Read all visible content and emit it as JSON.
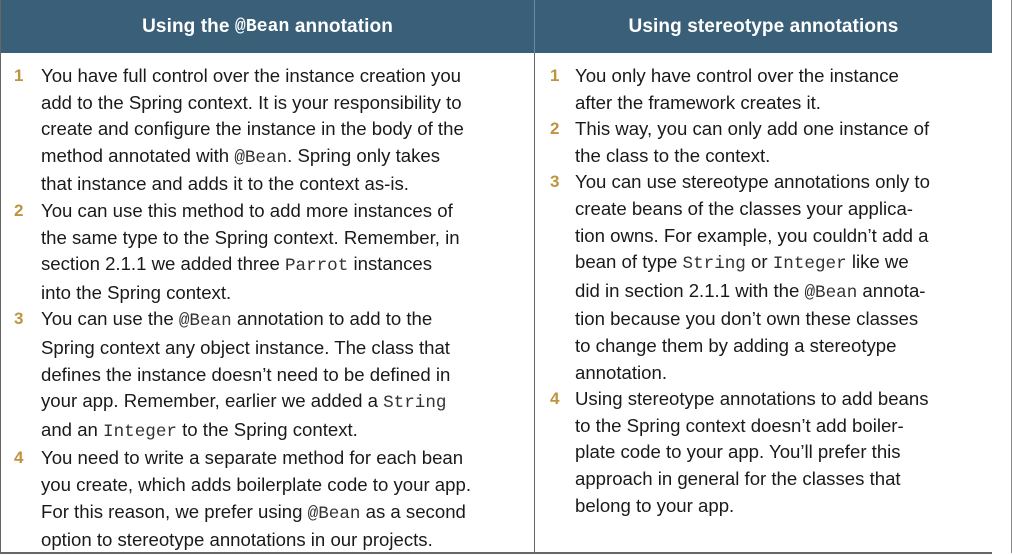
{
  "table": {
    "left_header": {
      "before": "Using the ",
      "code": "@Bean",
      "after": " annotation"
    },
    "right_header": "Using stereotype annotations",
    "left_items": [
      {
        "number": "1",
        "lines": [
          [
            {
              "t": "You have full control over the instance creation you"
            }
          ],
          [
            {
              "t": "add to the Spring context. It is your responsibility to"
            }
          ],
          [
            {
              "t": "create and configure the instance in the body of the"
            }
          ],
          [
            {
              "t": "method annotated with "
            },
            {
              "c": "@Bean"
            },
            {
              "t": ". Spring only takes"
            }
          ],
          [
            {
              "t": "that instance and adds it to the context as-is."
            }
          ]
        ]
      },
      {
        "number": "2",
        "lines": [
          [
            {
              "t": "You can use this method to add more instances of"
            }
          ],
          [
            {
              "t": "the same type to the Spring context. Remember, in"
            }
          ],
          [
            {
              "t": "section 2.1.1 we added three "
            },
            {
              "c": "Parrot"
            },
            {
              "t": " instances"
            }
          ],
          [
            {
              "t": "into the Spring context."
            }
          ]
        ]
      },
      {
        "number": "3",
        "lines": [
          [
            {
              "t": "You can use the "
            },
            {
              "c": "@Bean"
            },
            {
              "t": " annotation to add to the"
            }
          ],
          [
            {
              "t": "Spring context any object instance. The class that"
            }
          ],
          [
            {
              "t": "defines the instance doesn’t need to be defined in"
            }
          ],
          [
            {
              "t": "your app. Remember, earlier we added a "
            },
            {
              "c": "String"
            }
          ],
          [
            {
              "t": "and an "
            },
            {
              "c": "Integer"
            },
            {
              "t": " to the Spring context."
            }
          ]
        ]
      },
      {
        "number": "4",
        "lines": [
          [
            {
              "t": "You need to write a separate method for each bean"
            }
          ],
          [
            {
              "t": "you create, which adds boilerplate code to your app."
            }
          ],
          [
            {
              "t": "For this reason, we prefer using "
            },
            {
              "c": "@Bean"
            },
            {
              "t": " as a second"
            }
          ],
          [
            {
              "t": "option to stereotype annotations in our projects."
            }
          ]
        ]
      }
    ],
    "right_items": [
      {
        "number": "1",
        "lines": [
          [
            {
              "t": "You only have control over the instance"
            }
          ],
          [
            {
              "t": "after the framework creates it."
            }
          ]
        ]
      },
      {
        "number": "2",
        "lines": [
          [
            {
              "t": "This way, you can only add one instance of"
            }
          ],
          [
            {
              "t": "the class to the context."
            }
          ]
        ]
      },
      {
        "number": "3",
        "lines": [
          [
            {
              "t": "You can use stereotype annotations only to"
            }
          ],
          [
            {
              "t": "create beans of the classes your applica-"
            }
          ],
          [
            {
              "t": "tion owns. For example, you couldn’t add a"
            }
          ],
          [
            {
              "t": "bean of type "
            },
            {
              "c": "String"
            },
            {
              "t": " or "
            },
            {
              "c": "Integer"
            },
            {
              "t": " like we"
            }
          ],
          [
            {
              "t": "did in section 2.1.1 with the "
            },
            {
              "c": "@Bean"
            },
            {
              "t": " annota-"
            }
          ],
          [
            {
              "t": "tion because you don’t own these classes"
            }
          ],
          [
            {
              "t": "to change them by adding a stereotype"
            }
          ],
          [
            {
              "t": "annotation."
            }
          ]
        ]
      },
      {
        "number": "4",
        "lines": [
          [
            {
              "t": "Using stereotype annotations to add beans"
            }
          ],
          [
            {
              "t": "to the Spring context doesn’t add boiler-"
            }
          ],
          [
            {
              "t": "plate code to your app. You’ll prefer this"
            }
          ],
          [
            {
              "t": "approach in general for the classes that"
            }
          ],
          [
            {
              "t": "belong to your app."
            }
          ]
        ]
      }
    ],
    "colors": {
      "header_background": "#3a5f79",
      "header_text": "#ffffff",
      "number_accent": "#c0933f",
      "body_text": "#1a1a1a"
    }
  }
}
